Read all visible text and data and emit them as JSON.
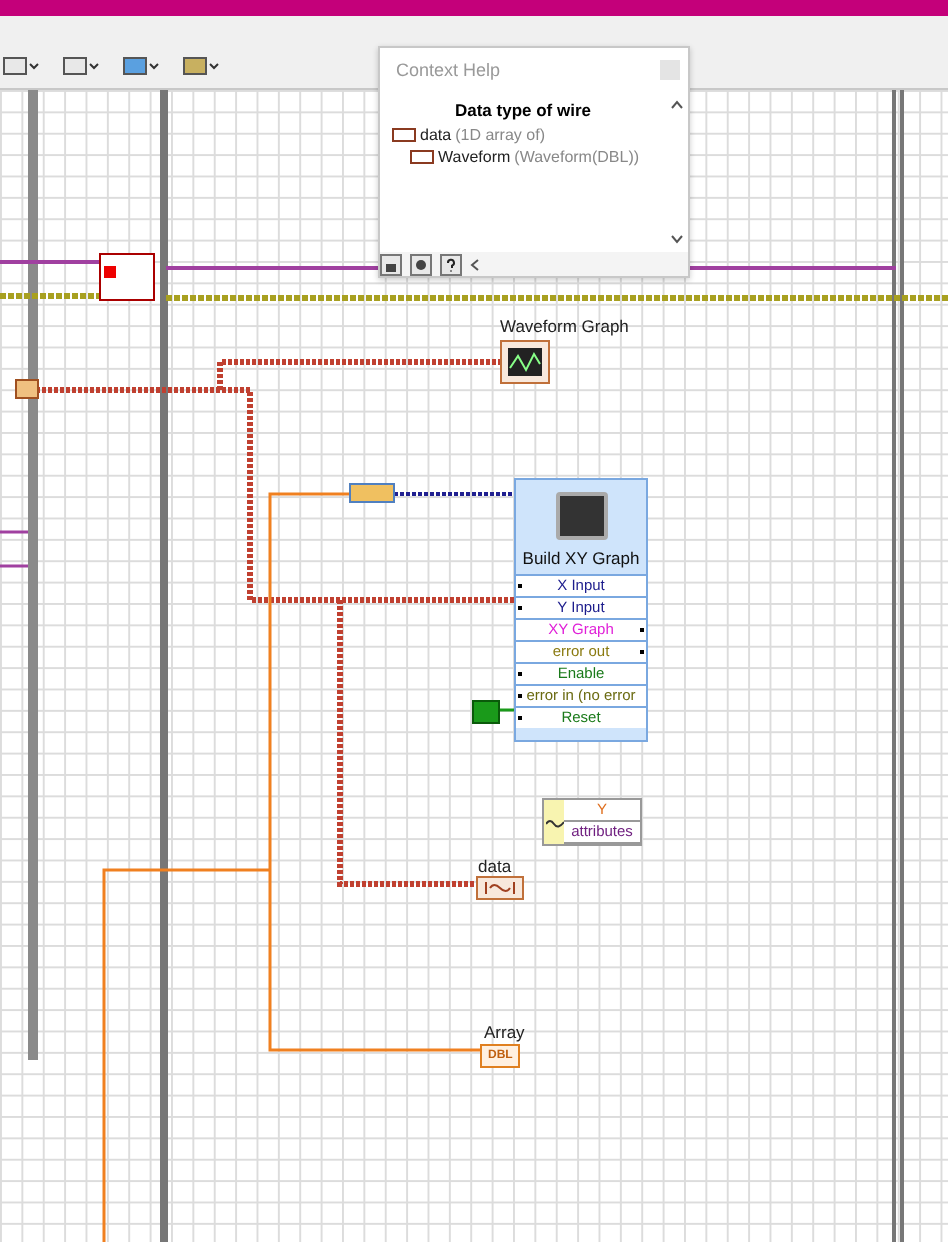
{
  "context_help": {
    "title": "Context Help",
    "heading": "Data type of wire",
    "items": [
      {
        "name": "data",
        "type": "(1D array of)",
        "children": [
          {
            "name": "Waveform",
            "type": "(Waveform(DBL))"
          }
        ]
      }
    ]
  },
  "diagram": {
    "waveform_graph": {
      "label": "Waveform Graph"
    },
    "build_xy_graph": {
      "title": "Build XY Graph",
      "terminals": [
        {
          "label": "X Input",
          "kind": "input",
          "color": "#1c1c8c"
        },
        {
          "label": "Y Input",
          "kind": "input",
          "color": "#1c1c8c"
        },
        {
          "label": "XY Graph",
          "kind": "output",
          "color": "#e020d8"
        },
        {
          "label": "error out",
          "kind": "output",
          "color": "#8a7a10"
        },
        {
          "label": "Enable",
          "kind": "input",
          "color": "#1a7a1a"
        },
        {
          "label": "error in (no error",
          "kind": "input",
          "color": "#6a6a10"
        },
        {
          "label": "Reset",
          "kind": "input",
          "color": "#1a7a1a"
        }
      ]
    },
    "unbundle": {
      "items": [
        {
          "label": "Y",
          "color": "#e07020"
        },
        {
          "label": "attributes",
          "color": "#702080"
        }
      ]
    },
    "data_indicator": {
      "label": "data"
    },
    "array_indicator": {
      "label": "Array",
      "type": "DBL"
    }
  }
}
